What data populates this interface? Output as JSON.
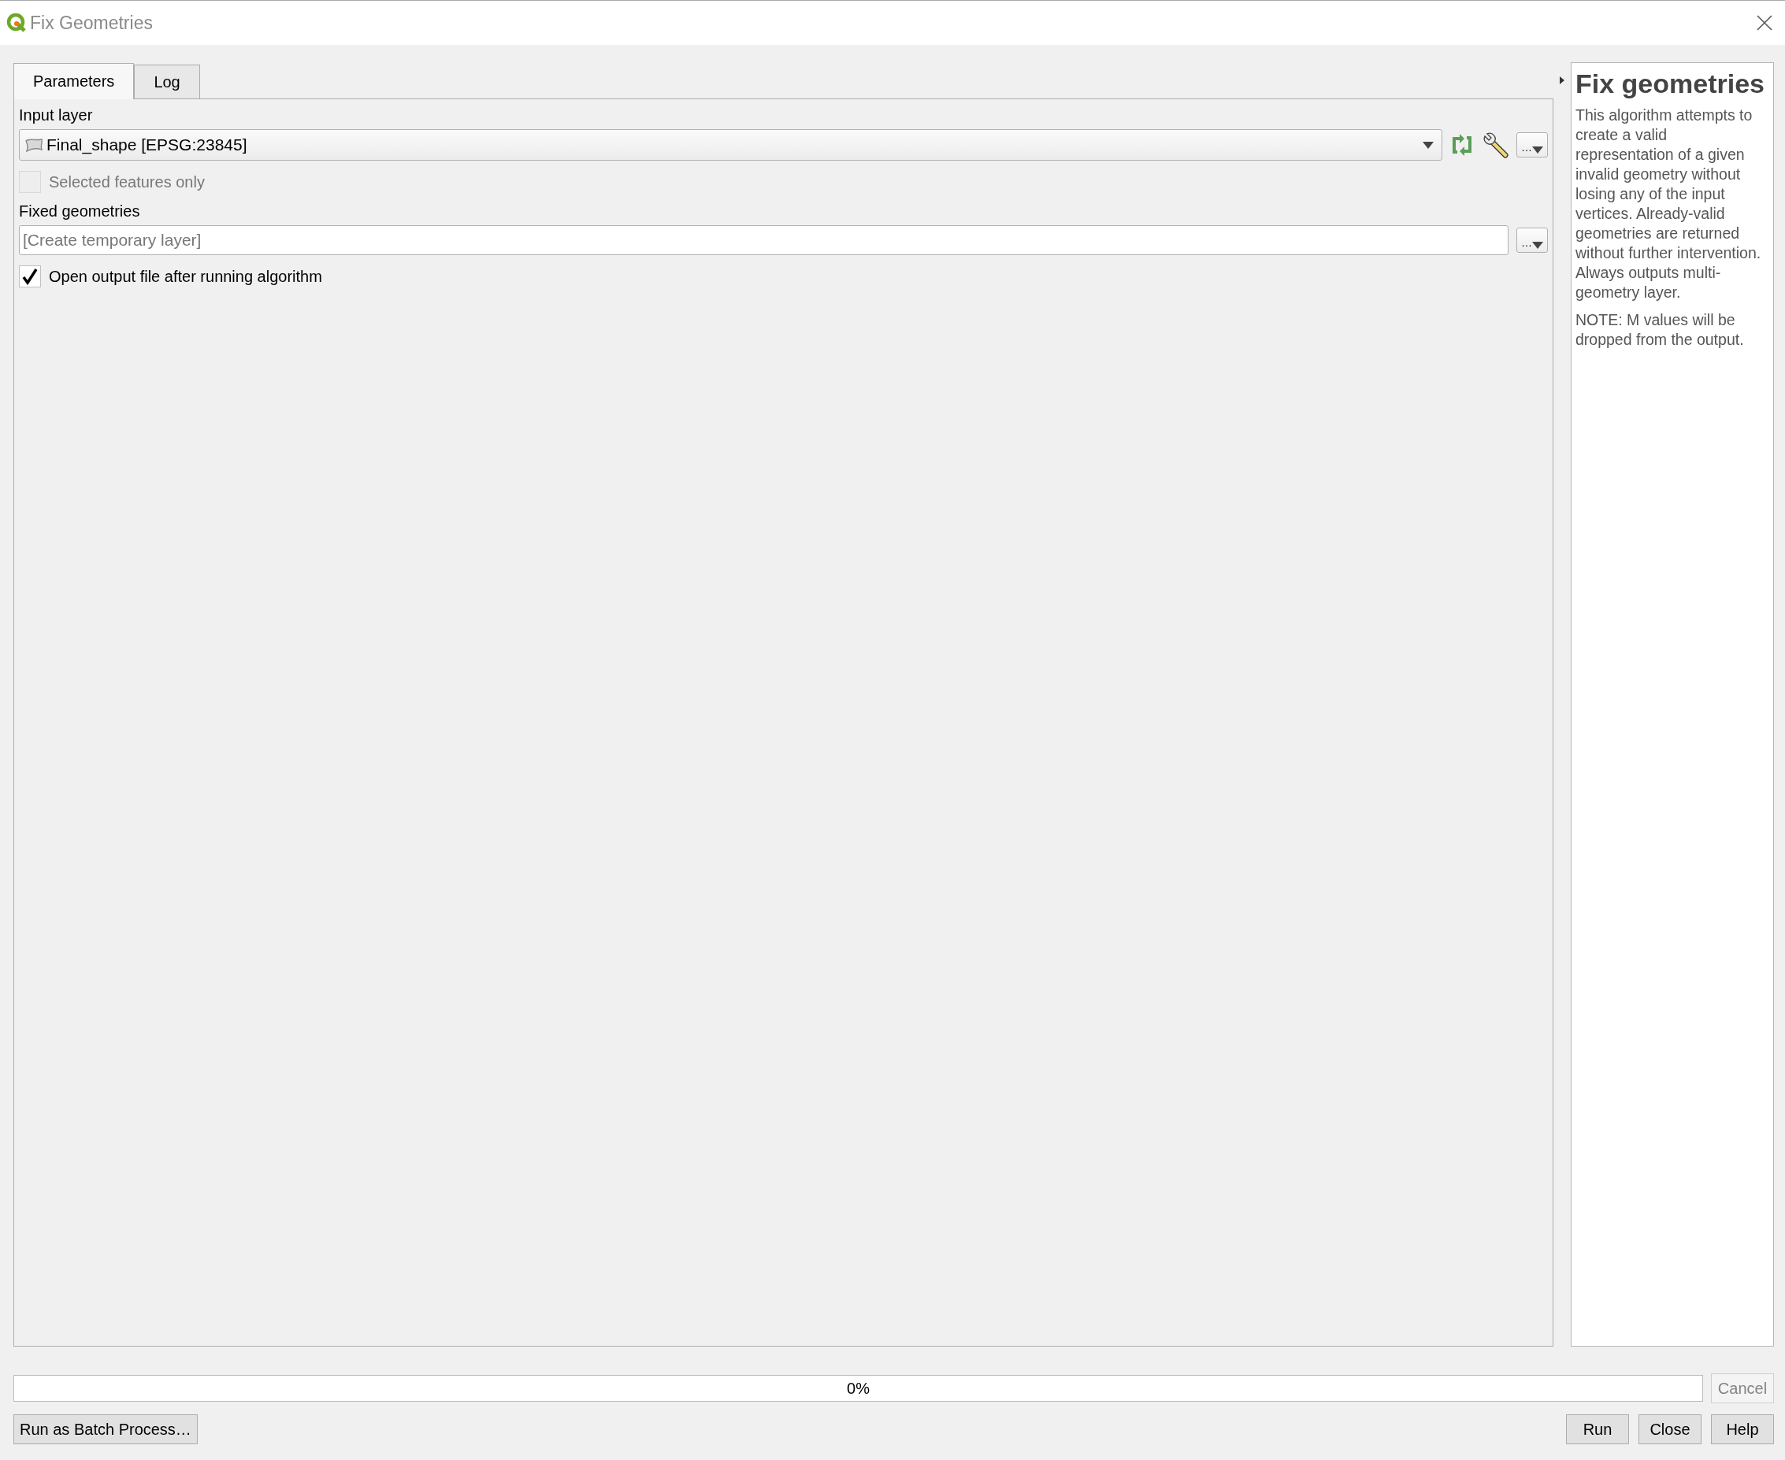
{
  "window": {
    "title": "Fix Geometries"
  },
  "tabs": [
    {
      "label": "Parameters",
      "selected": true
    },
    {
      "label": "Log",
      "selected": false
    }
  ],
  "parameters": {
    "input_layer": {
      "label": "Input layer",
      "value": "Final_shape [EPSG:23845]",
      "more_button": "…"
    },
    "selected_features_only": {
      "label": "Selected features only",
      "checked": false,
      "disabled": true
    },
    "fixed_geometries": {
      "label": "Fixed geometries",
      "placeholder": "[Create temporary layer]",
      "more_button": "…"
    },
    "open_output": {
      "label": "Open output file after running algorithm",
      "checked": true,
      "disabled": false
    }
  },
  "help": {
    "title": "Fix geometries",
    "paragraphs": [
      "This algorithm attempts to create a valid representation of a given invalid geometry without losing any of the input vertices. Already-valid geometries are returned without further intervention. Always outputs multi-geometry layer.",
      "NOTE: M values will be dropped from the output."
    ]
  },
  "progress": {
    "level": 0,
    "reading": "0%"
  },
  "cancel_button": {
    "label": "Cancel",
    "disabled": true
  },
  "left_buttons": [
    {
      "label": "Run as Batch Process…"
    }
  ],
  "right_buttons": [
    {
      "label": "Run"
    },
    {
      "label": "Close"
    },
    {
      "label": "Help"
    }
  ]
}
